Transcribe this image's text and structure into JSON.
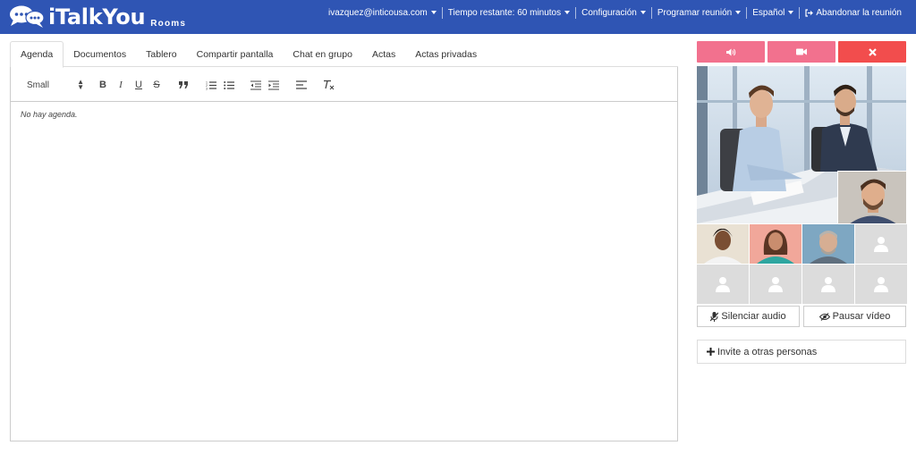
{
  "header": {
    "brand": "iTalkYou",
    "brand_sub": "Rooms",
    "nav": {
      "user": "ivazquez@inticousa.com",
      "time_left": "Tiempo restante: 60 minutos",
      "settings": "Configuración",
      "schedule": "Programar reunión",
      "language": "Español",
      "leave": "Abandonar la reunión"
    },
    "bg_color": "#2f55b4"
  },
  "tabs": [
    "Agenda",
    "Documentos",
    "Tablero",
    "Compartir pantalla",
    "Chat en grupo",
    "Actas",
    "Actas privadas"
  ],
  "toolbar": {
    "size": "Small"
  },
  "editor": {
    "empty_text": "No hay agenda."
  },
  "controls": {
    "audio_label": "Silenciar audio",
    "video_label": "Pausar vídeo",
    "invite_label": "Invite a otras personas",
    "colors": {
      "pink": "#f2718e",
      "red": "#f24d4d"
    }
  }
}
